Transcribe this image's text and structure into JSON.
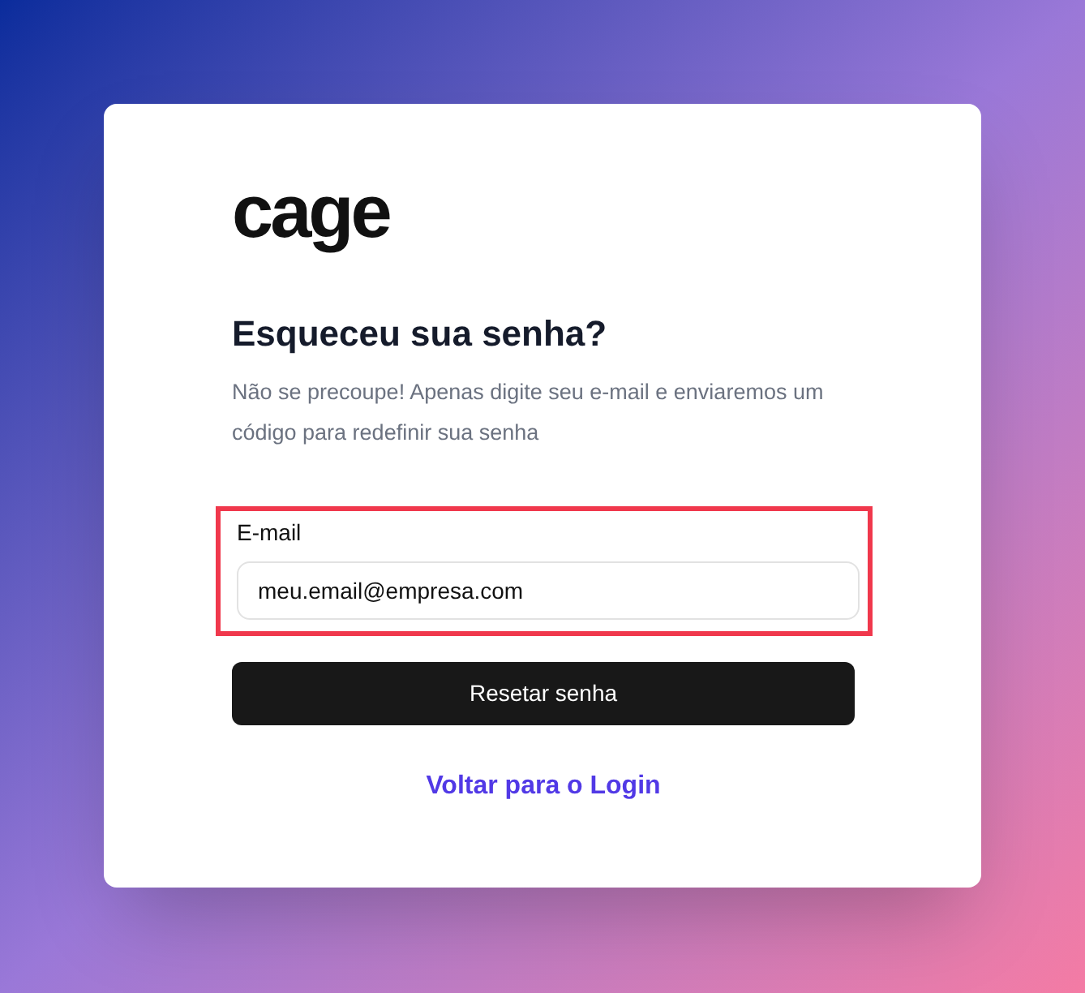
{
  "logo": "cage",
  "heading": "Esqueceu sua senha?",
  "description": "Não se precoupe! Apenas digite seu e-mail e enviaremos um código para redefinir sua senha",
  "email_field": {
    "label": "E-mail",
    "value": "meu.email@empresa.com",
    "highlighted": true
  },
  "submit_button": "Resetar senha",
  "back_link": "Voltar para o Login"
}
